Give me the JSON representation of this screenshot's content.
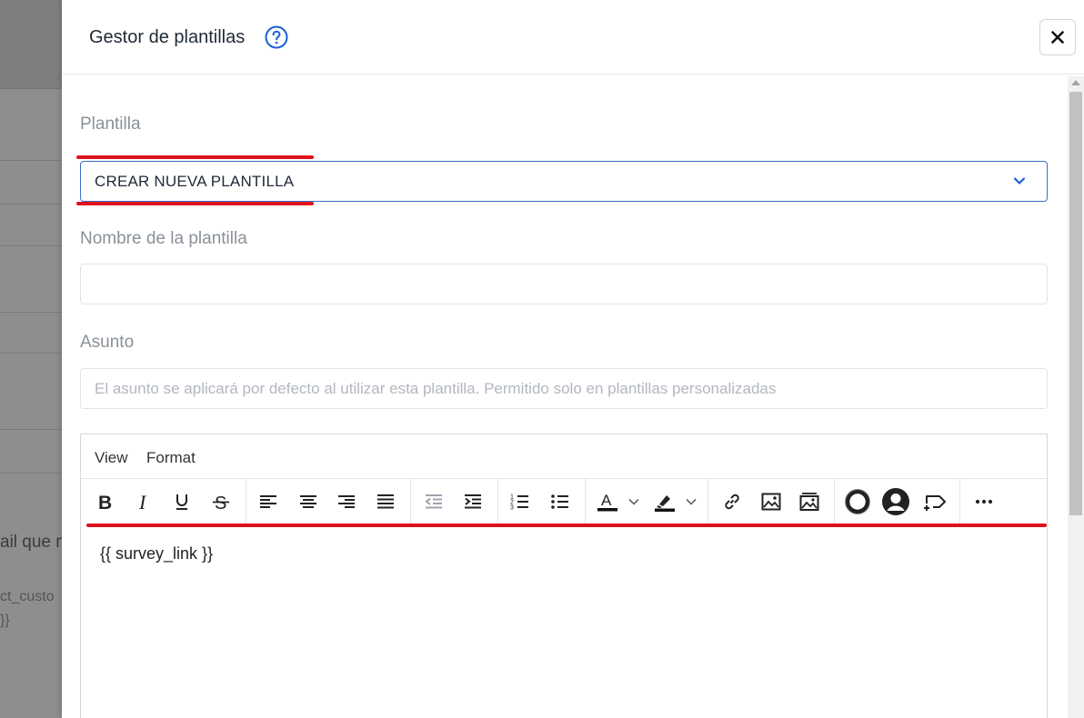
{
  "background": {
    "text_1": "ail que n",
    "text_2": "ct_custo",
    "text_3": "}}"
  },
  "modal": {
    "title": "Gestor de plantillas",
    "help_icon": "question-circle-icon",
    "close_icon": "close-icon"
  },
  "form": {
    "template_label": "Plantilla",
    "template_value": "CREAR NUEVA PLANTILLA",
    "name_label": "Nombre de la plantilla",
    "name_value": "",
    "subject_label": "Asunto",
    "subject_placeholder": "El asunto se aplicará por defecto al utilizar esta plantilla. Permitido solo en plantillas personalizadas"
  },
  "editor": {
    "menu": [
      "View",
      "Format"
    ],
    "content": "{{ survey_link }}"
  },
  "colors": {
    "accent": "#1a5fd6",
    "highlight_mark": "#e0111d"
  }
}
